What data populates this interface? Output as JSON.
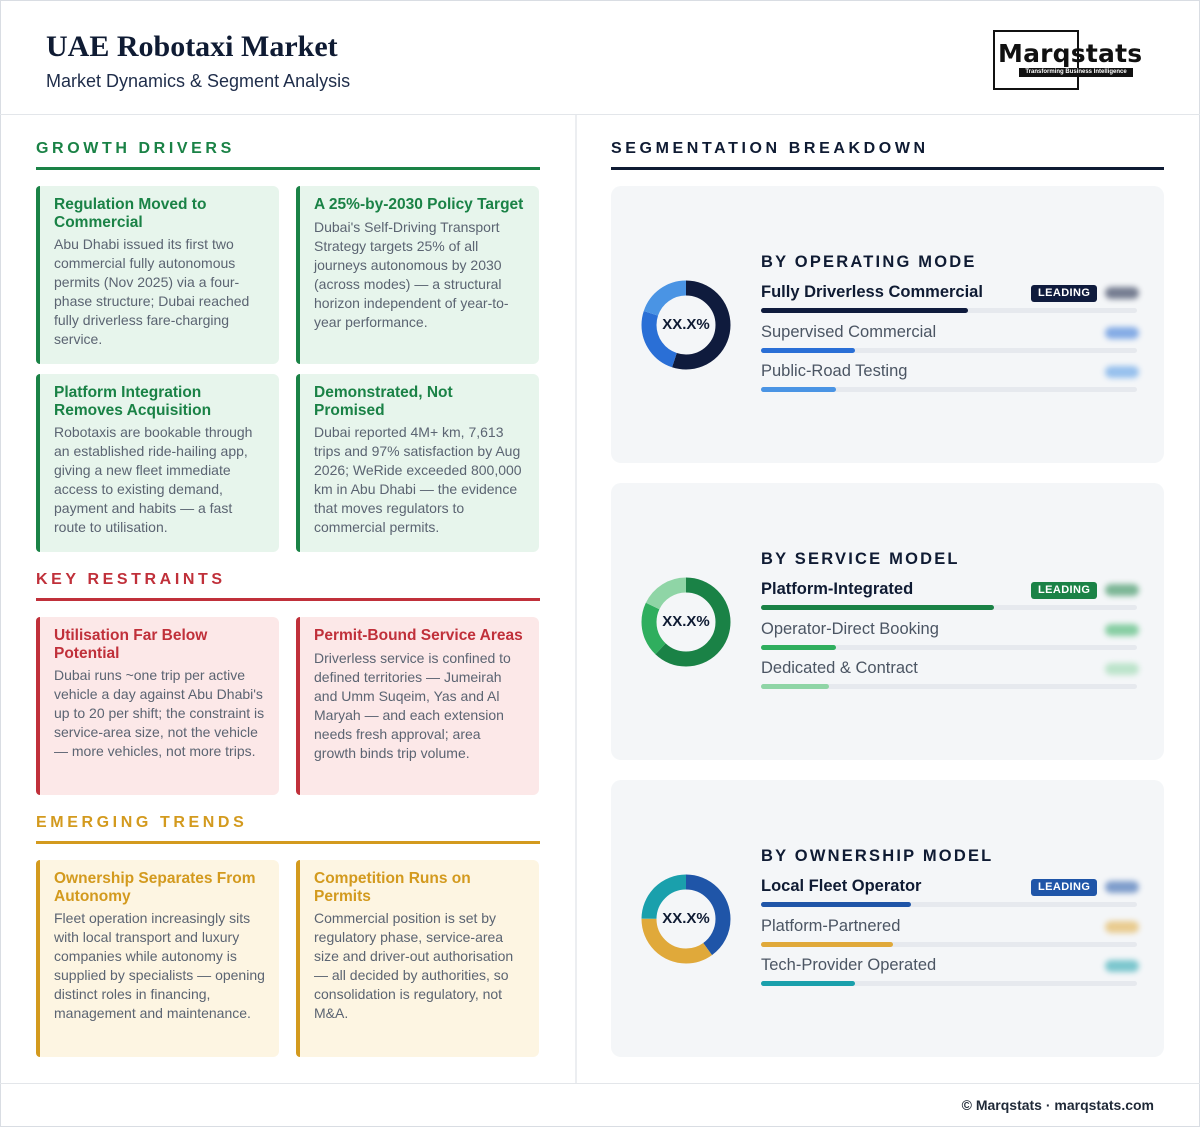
{
  "header": {
    "title": "UAE Robotaxi Market",
    "subtitle": "Market Dynamics & Segment Analysis",
    "logo_text": "Marqstats",
    "logo_tagline": "Transforming Business Intelligence"
  },
  "growth_drivers": {
    "heading": "GROWTH DRIVERS",
    "color": "#1a8246",
    "cards": [
      {
        "title": "Regulation Moved to Commercial",
        "body": "Abu Dhabi issued its first two commercial fully autonomous permits (Nov 2025) via a four-phase structure; Dubai reached fully driverless fare-charging service."
      },
      {
        "title": "A 25%-by-2030 Policy Target",
        "body": "Dubai's Self-Driving Transport Strategy targets 25% of all journeys autonomous by 2030 (across modes) — a structural horizon independent of year-to-year performance."
      },
      {
        "title": "Platform Integration Removes Acquisition",
        "body": "Robotaxis are bookable through an established ride-hailing app, giving a new fleet immediate access to existing demand, payment and habits — a fast route to utilisation."
      },
      {
        "title": "Demonstrated, Not Promised",
        "body": "Dubai reported 4M+ km, 7,613 trips and 97% satisfaction by Aug 2026; WeRide exceeded 800,000 km in Abu Dhabi — the evidence that moves regulators to commercial permits."
      }
    ]
  },
  "key_restraints": {
    "heading": "KEY RESTRAINTS",
    "color": "#c0303a",
    "cards": [
      {
        "title": "Utilisation Far Below Potential",
        "body": "Dubai runs ~one trip per active vehicle a day against Abu Dhabi's up to 20 per shift; the constraint is service-area size, not the vehicle — more vehicles, not more trips."
      },
      {
        "title": "Permit-Bound Service Areas",
        "body": "Driverless service is confined to defined territories — Jumeirah and Umm Suqeim, Yas and Al Maryah — and each extension needs fresh approval; area growth binds trip volume."
      }
    ]
  },
  "emerging_trends": {
    "heading": "EMERGING TRENDS",
    "color": "#d39a1e",
    "cards": [
      {
        "title": "Ownership Separates From Autonomy",
        "body": "Fleet operation increasingly sits with local transport and luxury companies while autonomy is supplied by specialists — opening distinct roles in financing, management and maintenance."
      },
      {
        "title": "Competition Runs on Permits",
        "body": "Commercial position is set by regulatory phase, service-area size and driver-out authorisation — all decided by authorities, so consolidation is regulatory, not M&A."
      }
    ]
  },
  "segmentation": {
    "heading": "SEGMENTATION BREAKDOWN",
    "badge_label": "LEADING",
    "panels": [
      {
        "title": "BY OPERATING MODE",
        "donut_label": "XX.X%",
        "rows": [
          {
            "label": "Fully Driverless Commercial",
            "share": 0.55,
            "color": "#0f1b3d",
            "leading": true
          },
          {
            "label": "Supervised Commercial",
            "share": 0.25,
            "color": "#2a6fd6",
            "leading": false
          },
          {
            "label": "Public-Road Testing",
            "share": 0.2,
            "color": "#4a94e4",
            "leading": false
          }
        ]
      },
      {
        "title": "BY SERVICE MODEL",
        "donut_label": "XX.X%",
        "rows": [
          {
            "label": "Platform-Integrated",
            "share": 0.62,
            "color": "#1a8246",
            "leading": true
          },
          {
            "label": "Operator-Direct Booking",
            "share": 0.2,
            "color": "#2fae5e",
            "leading": false
          },
          {
            "label": "Dedicated & Contract",
            "share": 0.18,
            "color": "#8fd5a6",
            "leading": false
          }
        ]
      },
      {
        "title": "BY OWNERSHIP MODEL",
        "donut_label": "XX.X%",
        "rows": [
          {
            "label": "Local Fleet Operator",
            "share": 0.4,
            "color": "#1f55a8",
            "leading": true
          },
          {
            "label": "Platform-Partnered",
            "share": 0.35,
            "color": "#e0a93a",
            "leading": false
          },
          {
            "label": "Tech-Provider Operated",
            "share": 0.25,
            "color": "#1aa0ac",
            "leading": false
          }
        ]
      }
    ]
  },
  "footer": {
    "text": "© Marqstats · marqstats.com"
  }
}
